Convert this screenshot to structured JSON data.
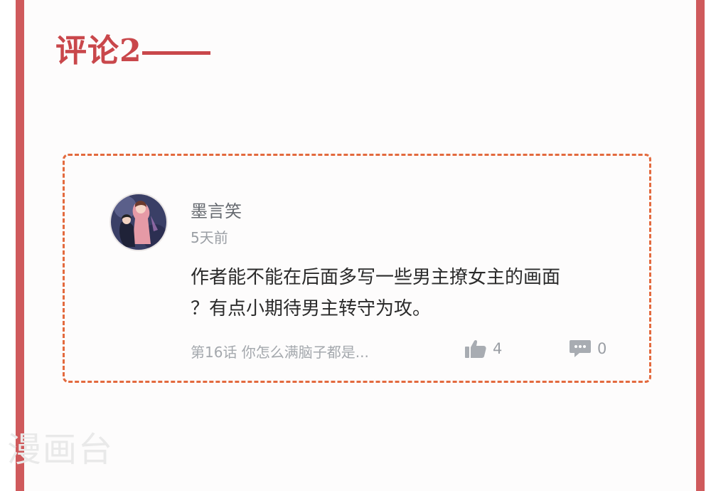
{
  "section": {
    "title": "评论2",
    "accent_color": "#c9474b",
    "frame_color": "#cf5a5c"
  },
  "comment": {
    "username": "墨言笑",
    "time": "5天前",
    "text_line1": "作者能不能在后面多写一些男主撩女主的画面",
    "text_line2": "？有点小期待男主转守为攻。",
    "chapter": "第16话 你怎么满脑子都是...",
    "likes": "4",
    "replies": "0",
    "avatar_icon": "avatar-image",
    "like_icon": "thumbs-up-icon",
    "reply_icon": "comment-icon",
    "border_color": "#e36a3e"
  },
  "watermark": "漫画台"
}
